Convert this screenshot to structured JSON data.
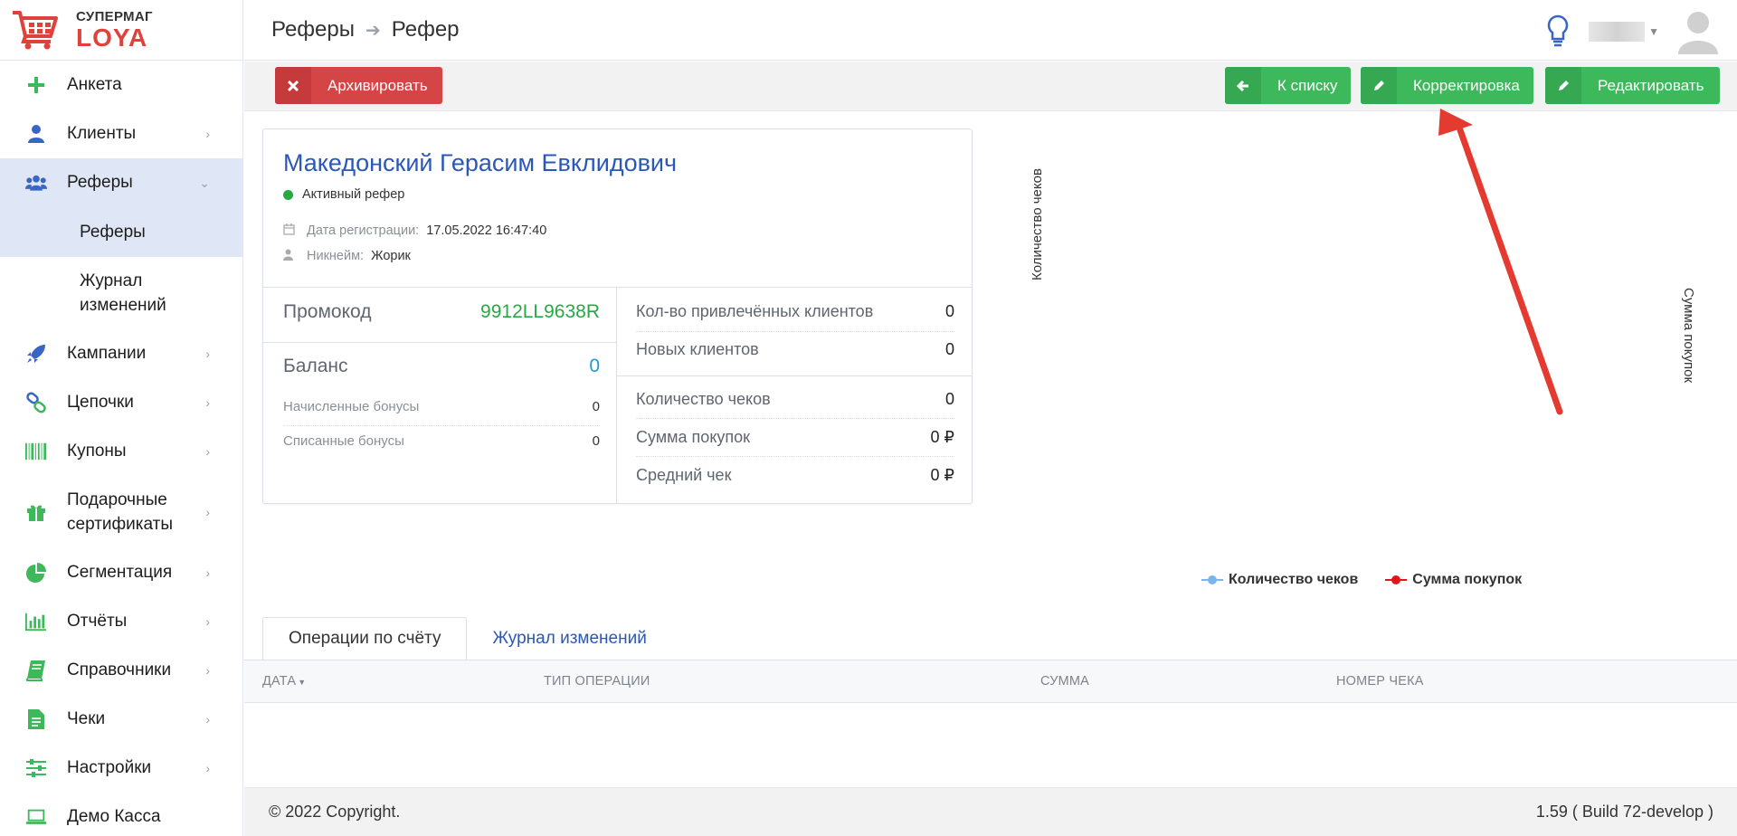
{
  "brand": {
    "top": "СУПЕРМАГ",
    "bottom": "LOYA",
    "accent": "#e0413a"
  },
  "sidebar": {
    "items": [
      {
        "label": "Анкета",
        "icon": "plus-icon"
      },
      {
        "label": "Клиенты",
        "icon": "user-icon"
      },
      {
        "label": "Реферы",
        "icon": "users-icon"
      },
      {
        "label": "Кампании",
        "icon": "rocket-icon"
      },
      {
        "label": "Цепочки",
        "icon": "chain-icon"
      },
      {
        "label": "Купоны",
        "icon": "barcode-icon"
      },
      {
        "label": "Подарочные сертификаты",
        "icon": "gift-icon"
      },
      {
        "label": "Сегментация",
        "icon": "pie-icon"
      },
      {
        "label": "Отчёты",
        "icon": "bar-chart-icon"
      },
      {
        "label": "Справочники",
        "icon": "book-icon"
      },
      {
        "label": "Чеки",
        "icon": "receipt-icon"
      },
      {
        "label": "Настройки",
        "icon": "sliders-icon"
      },
      {
        "label": "Демо Касса",
        "icon": "laptop-icon"
      }
    ],
    "subitems": [
      {
        "label": "Реферы"
      },
      {
        "label": "Журнал изменений"
      }
    ]
  },
  "header": {
    "crumb1": "Реферы",
    "crumb2": "Рефер"
  },
  "toolbar": {
    "archive": "Архивировать",
    "to_list": "К списку",
    "correct": "Корректировка",
    "edit": "Редактировать"
  },
  "referer": {
    "name": "Македонский Герасим Евклидович",
    "status": "Активный рефер",
    "reg_label": "Дата регистрации:",
    "reg_value": "17.05.2022 16:47:40",
    "nick_label": "Никнейм:",
    "nick_value": "Жорик",
    "promo_label": "Промокод",
    "promo_value": "9912LL9638R",
    "balance_label": "Баланс",
    "balance_value": "0",
    "accrued_label": "Начисленные бонусы",
    "accrued_value": "0",
    "spent_label": "Списанные бонусы",
    "spent_value": "0"
  },
  "stats": {
    "attracted_label": "Кол-во привлечённых клиентов",
    "attracted_value": "0",
    "new_label": "Новых клиентов",
    "new_value": "0",
    "checks_label": "Количество чеков",
    "checks_value": "0",
    "sum_label": "Сумма покупок",
    "sum_value": "0 ₽",
    "avg_label": "Средний чек",
    "avg_value": "0 ₽"
  },
  "chart": {
    "y_left": "Количество чеков",
    "y_right": "Сумма покупок",
    "legend": [
      {
        "name": "Количество чеков",
        "color": "#7cb5ec"
      },
      {
        "name": "Сумма покупок",
        "color": "#e8101b"
      }
    ]
  },
  "tabs": {
    "operations": "Операции по счёту",
    "log": "Журнал изменений"
  },
  "table": {
    "date": "ДАТА",
    "type": "ТИП ОПЕРАЦИИ",
    "sum": "СУММА",
    "check": "НОМЕР ЧЕКА"
  },
  "footer": {
    "copyright": "© 2022 Copyright.",
    "version": "1.59 ( Build 72-develop )"
  }
}
